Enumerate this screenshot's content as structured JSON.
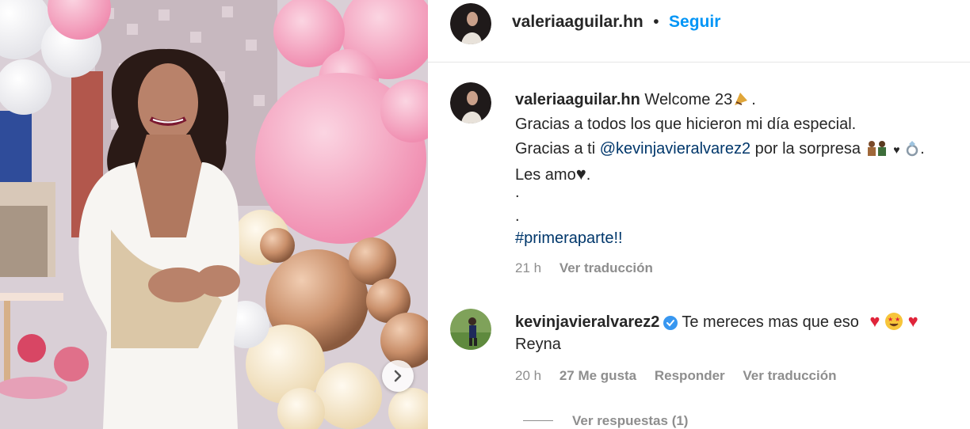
{
  "post_image": {
    "alt_icon": "chevron-right-icon"
  },
  "header": {
    "username": "valeriaaguilar.hn",
    "separator": "•",
    "follow_label": "Seguir"
  },
  "caption": {
    "username": "valeriaaguilar.hn",
    "line1": "Welcome 23",
    "line1_end": ".",
    "line2": "Gracias a todos los que hicieron mi día especial.",
    "line3_pre": "Gracias a ti ",
    "line3_mention": "@kevinjavieralvarez2",
    "line3_post": " por la sorpresa",
    "line3_end": ".",
    "line4": "Les amo",
    "line4_end": ".",
    "dot1": ".",
    "dot2": ".",
    "hashtag": "#primeraparte!!",
    "time": "21 h",
    "translate": "Ver traducción"
  },
  "comment": {
    "username": "kevinjavieralvarez2",
    "text": "Te mereces mas que eso",
    "text_line2": "Reyna",
    "time": "20 h",
    "likes": "27 Me gusta",
    "reply": "Responder",
    "translate": "Ver traducción",
    "view_replies": "Ver respuestas (1)"
  },
  "colors": {
    "accent": "#0095f6",
    "link": "#00376b",
    "muted": "#8e8e8e"
  }
}
